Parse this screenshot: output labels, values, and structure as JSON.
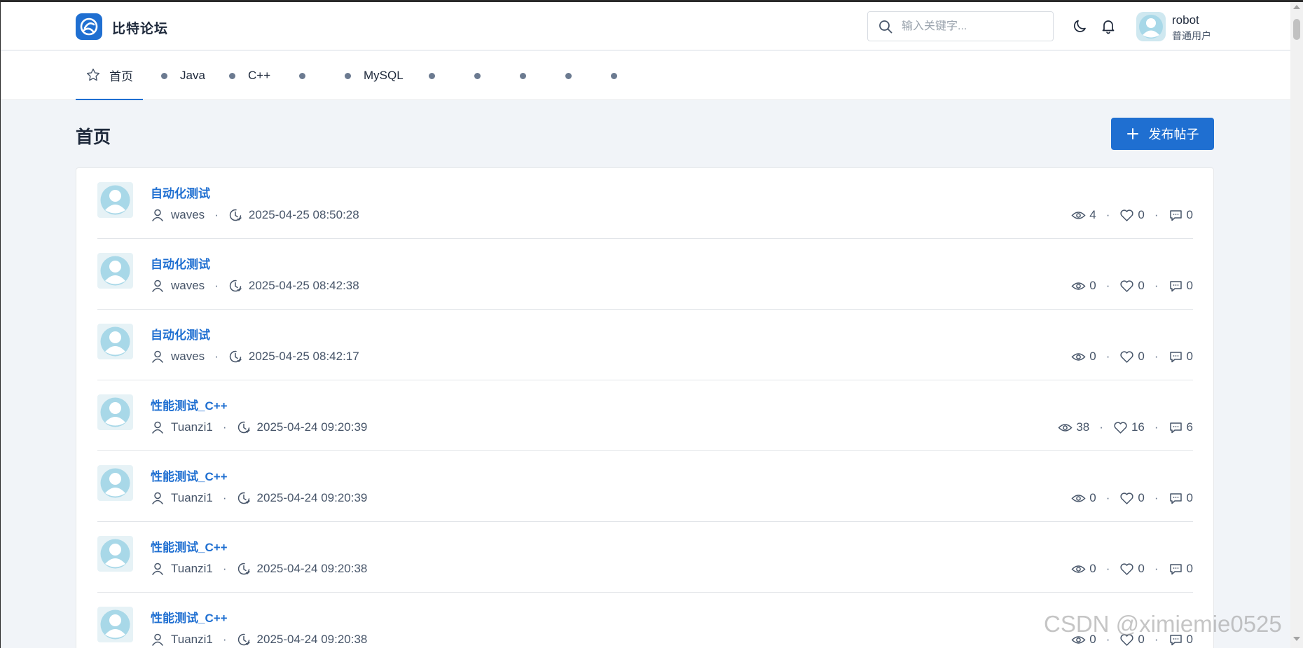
{
  "header": {
    "site_title": "比特论坛",
    "search_placeholder": "输入关键字...",
    "user_name": "robot",
    "user_role": "普通用户",
    "icons": [
      "logo-icon",
      "search-icon",
      "moon-icon",
      "bell-icon",
      "avatar"
    ]
  },
  "nav": {
    "home_label": "首页",
    "items": [
      {
        "label": "Java"
      },
      {
        "label": "C++"
      },
      {
        "label": ""
      },
      {
        "label": "MySQL"
      },
      {
        "label": ""
      },
      {
        "label": ""
      },
      {
        "label": ""
      },
      {
        "label": ""
      },
      {
        "label": ""
      }
    ]
  },
  "page": {
    "title": "首页",
    "publish_label": "发布帖子"
  },
  "posts": [
    {
      "title": "自动化测试",
      "author": "waves",
      "time": "2025-04-25 08:50:28",
      "views": "4",
      "likes": "0",
      "comments": "0"
    },
    {
      "title": "自动化测试",
      "author": "waves",
      "time": "2025-04-25 08:42:38",
      "views": "0",
      "likes": "0",
      "comments": "0"
    },
    {
      "title": "自动化测试",
      "author": "waves",
      "time": "2025-04-25 08:42:17",
      "views": "0",
      "likes": "0",
      "comments": "0"
    },
    {
      "title": "性能测试_C++",
      "author": "Tuanzi1",
      "time": "2025-04-24 09:20:39",
      "views": "38",
      "likes": "16",
      "comments": "6"
    },
    {
      "title": "性能测试_C++",
      "author": "Tuanzi1",
      "time": "2025-04-24 09:20:39",
      "views": "0",
      "likes": "0",
      "comments": "0"
    },
    {
      "title": "性能测试_C++",
      "author": "Tuanzi1",
      "time": "2025-04-24 09:20:38",
      "views": "0",
      "likes": "0",
      "comments": "0"
    },
    {
      "title": "性能测试_C++",
      "author": "Tuanzi1",
      "time": "2025-04-24 09:20:38",
      "views": "0",
      "likes": "0",
      "comments": "0"
    }
  ],
  "watermark": "CSDN @ximiemie0525",
  "colors": {
    "accent": "#1f6fd1",
    "background": "#f1f4f8",
    "text": "#1e293b",
    "muted": "#475569"
  }
}
